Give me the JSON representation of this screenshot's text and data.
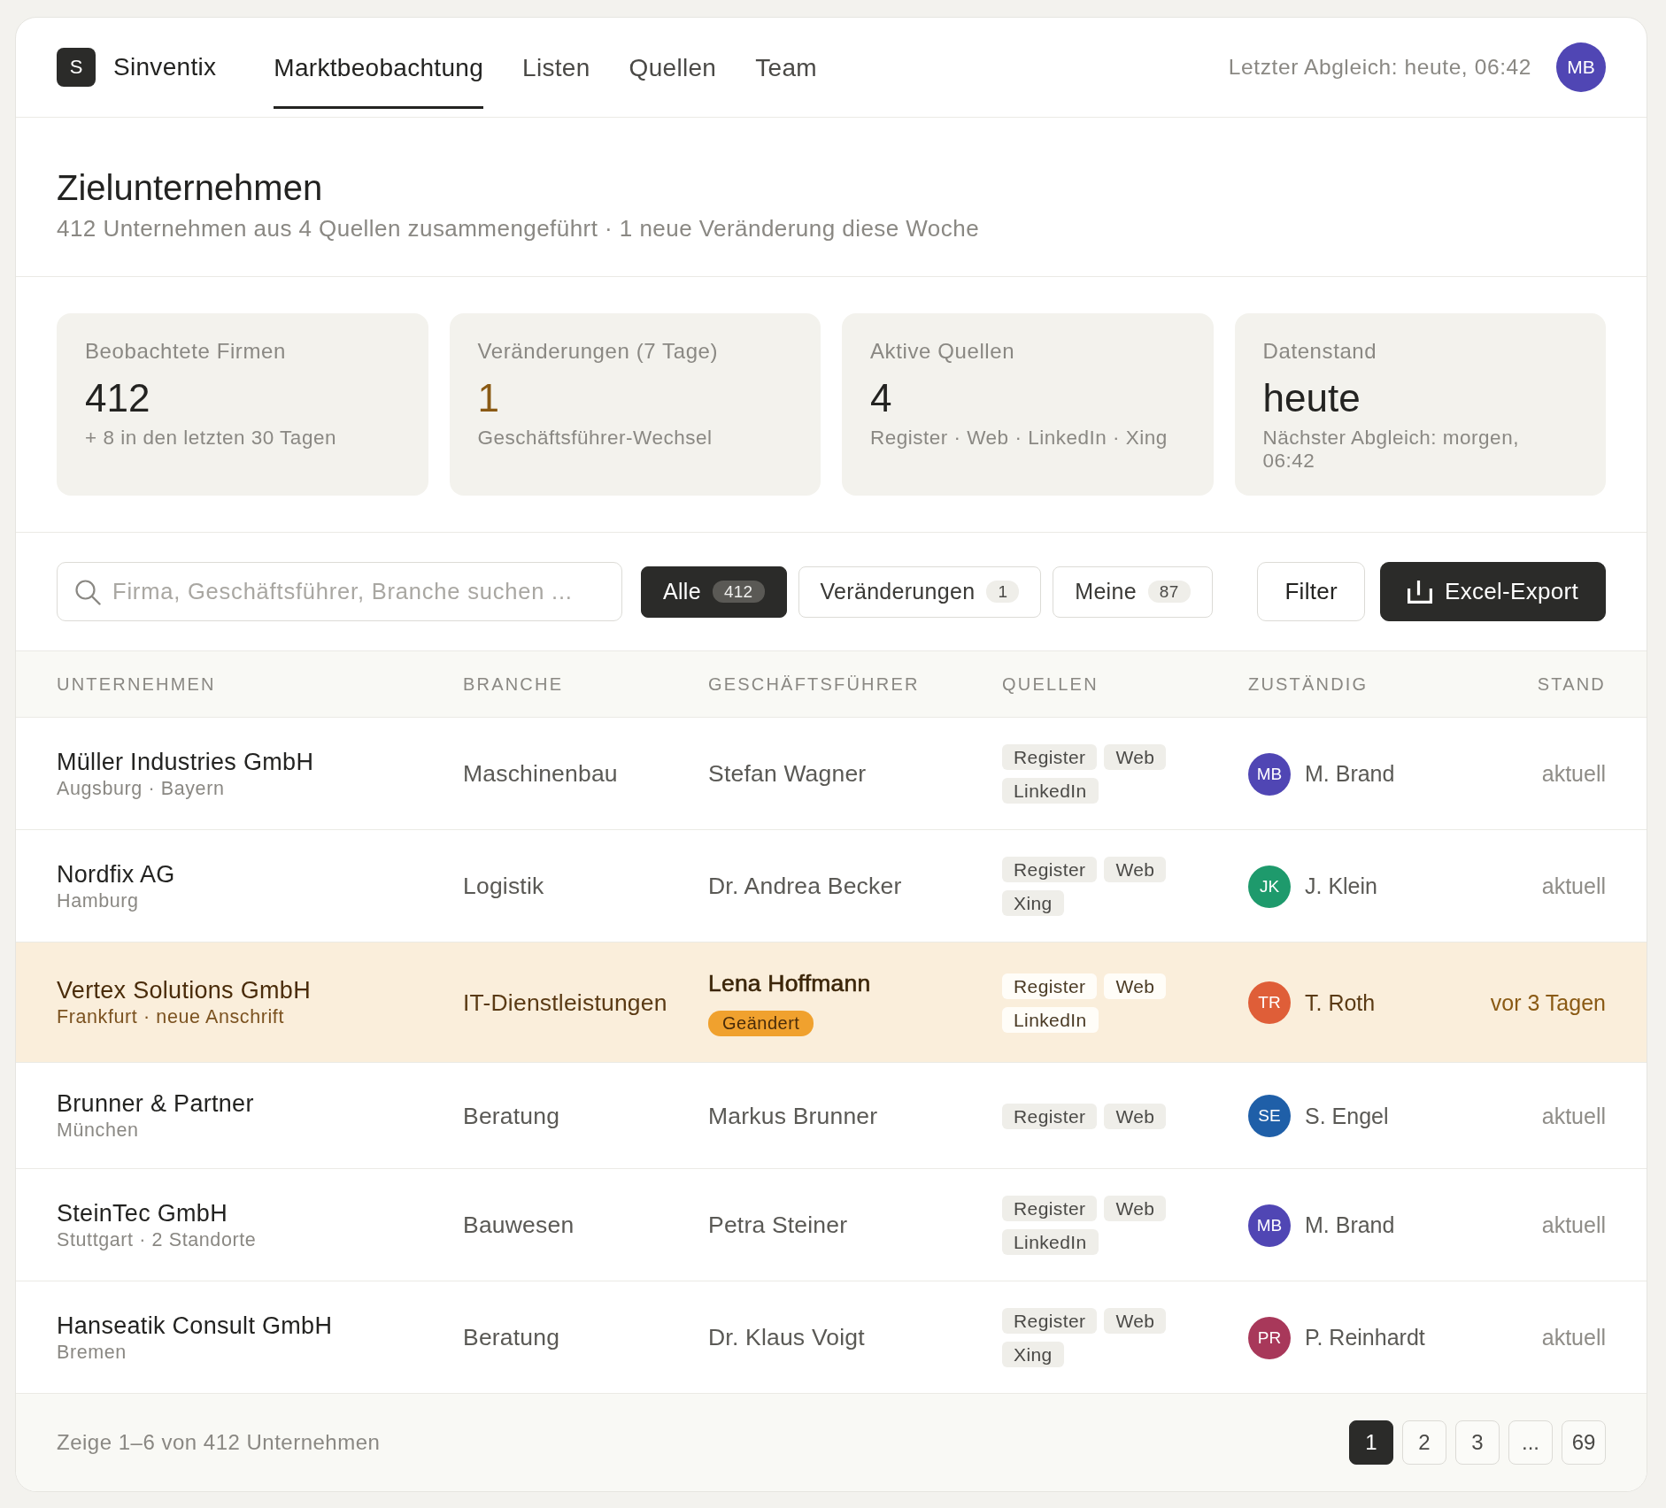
{
  "app": {
    "logo_letter": "S",
    "name": "Sinventix"
  },
  "nav": [
    {
      "label": "Marktbeobachtung",
      "selected": true
    },
    {
      "label": "Listen",
      "selected": false
    },
    {
      "label": "Quellen",
      "selected": false
    },
    {
      "label": "Team",
      "selected": false
    }
  ],
  "sync_status": "Letzter Abgleich: heute, 06:42",
  "user": {
    "initials": "MB"
  },
  "page": {
    "title": "Zielunternehmen",
    "subtitle": "412 Unternehmen aus 4 Quellen zusammengeführt · 1 neue Veränderung diese Woche"
  },
  "stats": [
    {
      "label": "Beobachtete Firmen",
      "value": "412",
      "note": "+ 8 in den letzten 30 Tagen",
      "highlighted": false
    },
    {
      "label": "Veränderungen (7 Tage)",
      "value": "1",
      "note": "Geschäftsführer-Wechsel",
      "highlighted": true
    },
    {
      "label": "Aktive Quellen",
      "value": "4",
      "note": "Register · Web · LinkedIn · Xing",
      "highlighted": false
    },
    {
      "label": "Datenstand",
      "value": "heute",
      "note": "Nächster Abgleich: morgen, 06:42",
      "highlighted": false
    }
  ],
  "search": {
    "placeholder": "Firma, Geschäftsführer, Branche suchen ..."
  },
  "filters": [
    {
      "label": "Alle",
      "count": "412",
      "selected": true
    },
    {
      "label": "Veränderungen",
      "count": "1",
      "selected": false
    },
    {
      "label": "Meine",
      "count": "87",
      "selected": false
    }
  ],
  "actions": [
    {
      "label": "Filter",
      "kind": "filter"
    },
    {
      "label": "Excel-Export",
      "kind": "export"
    }
  ],
  "table": {
    "columns": [
      "UNTERNEHMEN",
      "BRANCHE",
      "GESCHÄFTSFÜHRER",
      "QUELLEN",
      "ZUSTÄNDIG",
      "STAND"
    ],
    "rows": [
      {
        "company": "Müller Industries GmbH",
        "location": "Augsburg · Bayern",
        "industry": "Maschinenbau",
        "director": "Stefan Wagner",
        "sources": [
          "Register",
          "Web",
          "LinkedIn"
        ],
        "assignee": {
          "initials": "MB",
          "name": "M. Brand",
          "color": "#5046b4"
        },
        "status": "aktuell",
        "changed": false
      },
      {
        "company": "Nordfix AG",
        "location": "Hamburg",
        "industry": "Logistik",
        "director": "Dr. Andrea Becker",
        "sources": [
          "Register",
          "Web",
          "Xing"
        ],
        "assignee": {
          "initials": "JK",
          "name": "J. Klein",
          "color": "#1e9a6c"
        },
        "status": "aktuell",
        "changed": false
      },
      {
        "company": "Vertex Solutions GmbH",
        "location": "Frankfurt · neue Anschrift",
        "industry": "IT-Dienstleistungen",
        "director": "Lena Hoffmann",
        "badge": "Geändert",
        "sources": [
          "Register",
          "Web",
          "LinkedIn"
        ],
        "assignee": {
          "initials": "TR",
          "name": "T. Roth",
          "color": "#df5e38"
        },
        "status": "vor 3 Tagen",
        "changed": true
      },
      {
        "company": "Brunner & Partner",
        "location": "München",
        "industry": "Beratung",
        "director": "Markus Brunner",
        "sources": [
          "Register",
          "Web"
        ],
        "assignee": {
          "initials": "SE",
          "name": "S. Engel",
          "color": "#1f5fa8"
        },
        "status": "aktuell",
        "changed": false
      },
      {
        "company": "SteinTec GmbH",
        "location": "Stuttgart · 2 Standorte",
        "industry": "Bauwesen",
        "director": "Petra Steiner",
        "sources": [
          "Register",
          "Web",
          "LinkedIn"
        ],
        "assignee": {
          "initials": "MB",
          "name": "M. Brand",
          "color": "#5046b4"
        },
        "status": "aktuell",
        "changed": false
      },
      {
        "company": "Hanseatik Consult GmbH",
        "location": "Bremen",
        "industry": "Beratung",
        "director": "Dr. Klaus Voigt",
        "sources": [
          "Register",
          "Web",
          "Xing"
        ],
        "assignee": {
          "initials": "PR",
          "name": "P. Reinhardt",
          "color": "#a8385a"
        },
        "status": "aktuell",
        "changed": false
      }
    ]
  },
  "footer": {
    "summary": "Zeige 1–6 von 412 Unternehmen",
    "pages": [
      {
        "label": "1",
        "selected": true
      },
      {
        "label": "2",
        "selected": false
      },
      {
        "label": "3",
        "selected": false
      },
      {
        "label": "...",
        "selected": false
      },
      {
        "label": "69",
        "selected": false
      }
    ]
  }
}
